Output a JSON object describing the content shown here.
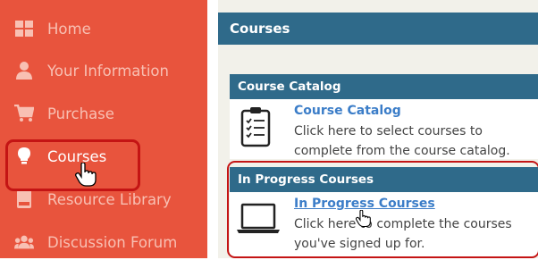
{
  "sidebar": {
    "items": [
      {
        "label": "Home",
        "icon": "grid-icon"
      },
      {
        "label": "Your Information",
        "icon": "user-icon"
      },
      {
        "label": "Purchase",
        "icon": "cart-icon"
      },
      {
        "label": "Courses",
        "icon": "lightbulb-icon"
      },
      {
        "label": "Resource Library",
        "icon": "book-icon"
      },
      {
        "label": "Discussion Forum",
        "icon": "users-icon"
      }
    ],
    "active": "Courses"
  },
  "main": {
    "title": "Courses",
    "catalog": {
      "header": "Course Catalog",
      "link": "Course Catalog",
      "description": "Click here to select courses to complete from the course catalog."
    },
    "in_progress": {
      "header": "In Progress Courses",
      "link": "In Progress Courses",
      "description": "Click here to complete the courses you've signed up for."
    }
  },
  "colors": {
    "sidebar_bg": "#e8543d",
    "header_bg": "#2f6a8a",
    "link": "#3b7dc8",
    "highlight": "#c41414"
  }
}
